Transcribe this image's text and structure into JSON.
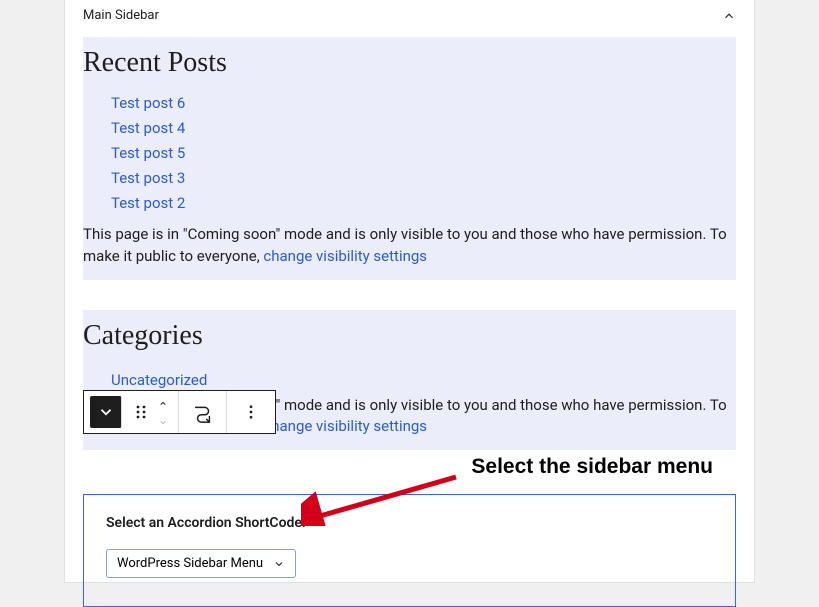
{
  "header": {
    "title": "Main Sidebar"
  },
  "recentPosts": {
    "title": "Recent Posts",
    "items": [
      "Test post 6",
      "Test post 4",
      "Test post 5",
      "Test post 3",
      "Test post 2"
    ]
  },
  "notice": {
    "text_before": "This page is in \"Coming soon\" mode and is only visible to you and those who have permission. To make it public to everyone, ",
    "link_text": "change visibility settings"
  },
  "categories": {
    "title": "Categories",
    "items": [
      "Uncategorized"
    ]
  },
  "accordionBlock": {
    "label": "Select an Accordion ShortCode:",
    "selected": "WordPress Sidebar Menu"
  },
  "annotation": {
    "text": "Select the sidebar menu"
  },
  "icons": {
    "block_type": "chevron-down",
    "drag": "drag-handle",
    "move_up": "chevron-up",
    "move_down": "chevron-down",
    "transform": "transform-path",
    "options": "vertical-ellipsis"
  }
}
